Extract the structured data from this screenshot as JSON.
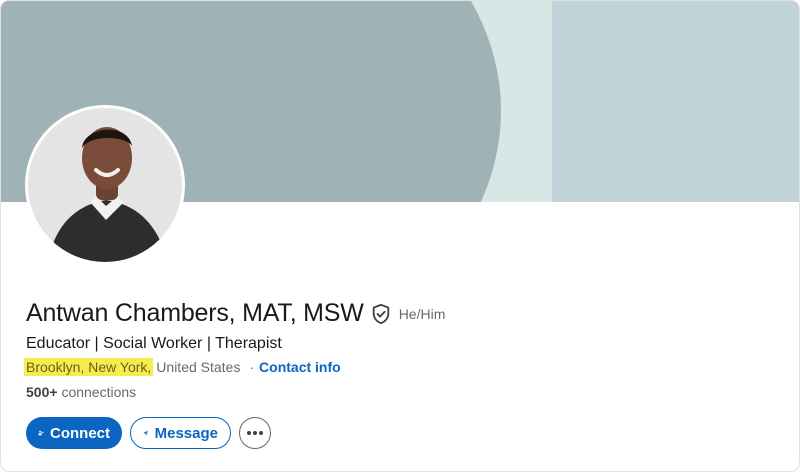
{
  "profile": {
    "name": "Antwan Chambers, MAT, MSW",
    "pronouns": "He/Him",
    "headline": "Educator | Social Worker | Therapist",
    "location_highlighted": "Brooklyn, New York,",
    "location_country": "United States",
    "separator": "·",
    "contact_info_label": "Contact info",
    "connections_count": "500+",
    "connections_label": "connections"
  },
  "actions": {
    "connect_label": "Connect",
    "message_label": "Message"
  },
  "icons": {
    "verify": "verified-shield-icon",
    "connect": "add-person-icon",
    "message": "paper-plane-icon",
    "more": "more-horizontal-icon"
  },
  "colors": {
    "brand": "#0a66c2",
    "highlight": "#f7ec4d",
    "banner_dark": "#9fb2b5",
    "banner_mid": "#d9e6e6",
    "banner_light": "#bfd3d8"
  }
}
